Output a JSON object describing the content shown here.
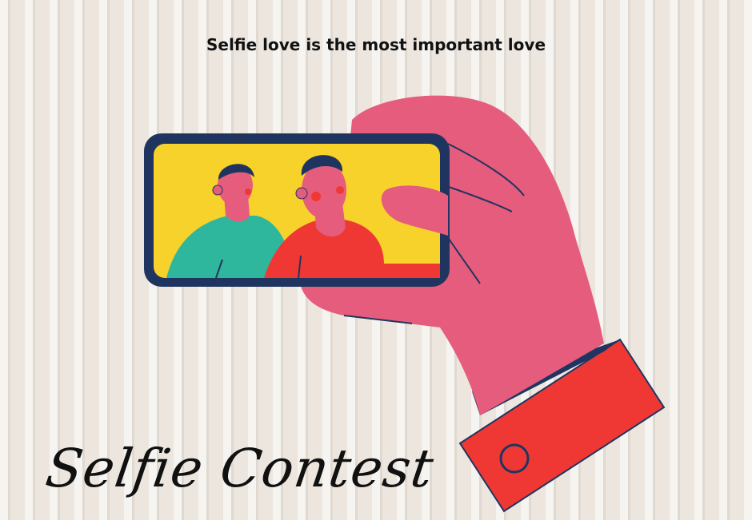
{
  "tagline": "Selfie love is the most important love",
  "title": "Selfie Contest",
  "colors": {
    "background": "#ece6df",
    "hand": "#e55c7c",
    "sleeve": "#ef3833",
    "phone_frame": "#1f3560",
    "screen": "#f6d22b",
    "shirt_left": "#2fb79d",
    "shirt_right": "#ef3833",
    "skin": "#e55c7c",
    "hair": "#1f3560"
  },
  "icons": [
    "hand-illustration",
    "phone-illustration",
    "sleeve-button-icon"
  ]
}
